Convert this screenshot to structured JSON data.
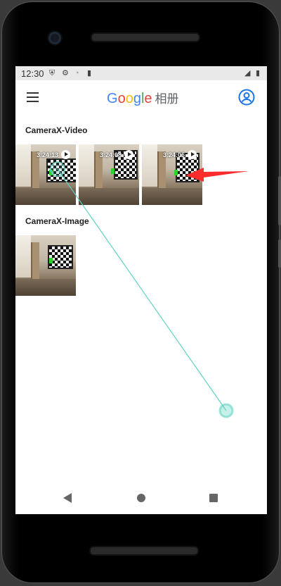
{
  "status_bar": {
    "time": "12:30"
  },
  "app_bar": {
    "brand_letters": [
      "G",
      "o",
      "o",
      "g",
      "l",
      "e"
    ],
    "brand_suffix": "相册"
  },
  "sections": [
    {
      "title": "CameraX-Video",
      "items": [
        {
          "duration": "3:24:13",
          "type": "video"
        },
        {
          "duration": "3:24:08",
          "type": "video"
        },
        {
          "duration": "3:24:06",
          "type": "video"
        }
      ]
    },
    {
      "title": "CameraX-Image",
      "items": [
        {
          "type": "image"
        }
      ]
    }
  ],
  "colors": {
    "google_blue": "#4285F4",
    "google_red": "#EA4335",
    "google_yellow": "#FBBC05",
    "google_green": "#34A853",
    "annotation_arrow": "#ff2d2d",
    "gesture_trail": "#5fd3c0"
  }
}
